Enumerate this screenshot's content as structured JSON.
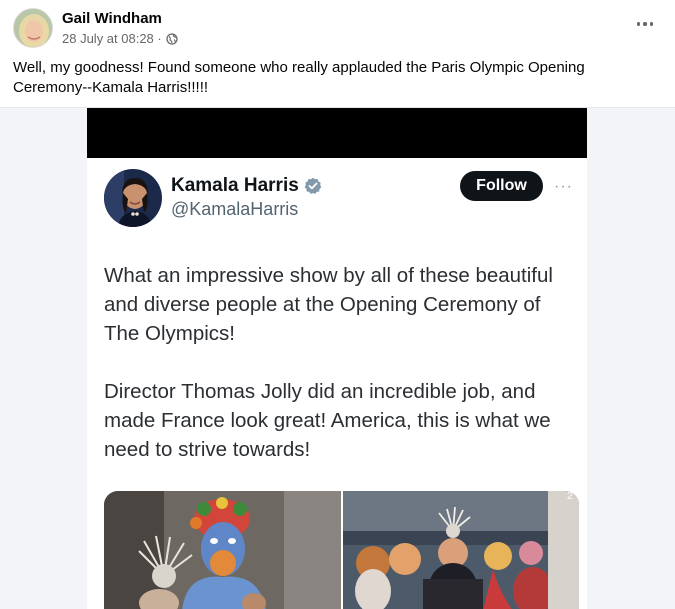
{
  "post": {
    "author": "Gail Windham",
    "timestamp": "28 July at 08:28 ·",
    "privacy_icon": "globe-icon",
    "text": "Well, my goodness!  Found someone who really applauded the Paris Olympic Opening Ceremony--Kamala Harris!!!!!"
  },
  "tweet": {
    "name": "Kamala Harris",
    "handle": "@KamalaHarris",
    "follow_label": "Follow",
    "more_label": "···",
    "paragraphs": [
      "What an impressive show by all of these beautiful and diverse people at the Opening Ceremony of The Olympics!",
      "Director Thomas Jolly did an incredible job, and made France look great! America, this is what we need to strive towards!"
    ],
    "photo_corner_label": "2"
  },
  "colors": {
    "accent_verified": "#1d9bf0",
    "follow_bg": "#0f1419",
    "meta_gray": "#65676b"
  }
}
